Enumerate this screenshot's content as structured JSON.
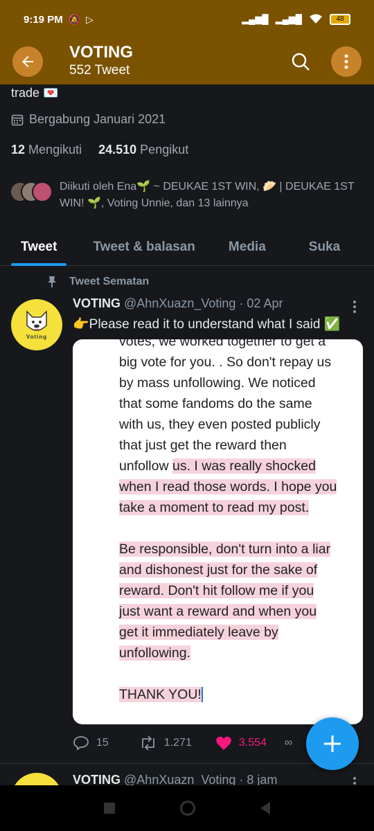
{
  "status_bar": {
    "time": "9:19 PM",
    "battery": "48"
  },
  "header": {
    "title": "VOTING",
    "subtitle": "552 Tweet"
  },
  "profile": {
    "bio_tail": "trade 💌",
    "joined": "Bergabung Januari 2021",
    "following_count": "12",
    "following_label": "Mengikuti",
    "followers_count": "24.510",
    "followers_label": "Pengikut",
    "followed_by": "Diikuti oleh Ena🌱 ~ DEUKAE 1ST WIN, 🥟 | DEUKAE 1ST WIN! 🌱, Voting Unnie, dan 13 lainnya"
  },
  "tabs": [
    {
      "label": "Tweet"
    },
    {
      "label": "Tweet & balasan"
    },
    {
      "label": "Media"
    },
    {
      "label": "Suka"
    }
  ],
  "pinned_tweet": {
    "pinned_label": "Tweet Sematan",
    "name": "VOTING",
    "handle_time": "@AhnXuazn_Voting · 02 Apr",
    "text": "👉Please read it to understand what I said ✅",
    "avatar_label": "Voting",
    "image_lines": {
      "l1": "votes, we worked together to get a",
      "l2": "big vote for you. . So don't repay us",
      "l3": "by mass unfollowing. We noticed",
      "l4": "that some fandoms do the same",
      "l5": "with us, they even posted publicly",
      "l6": "that just get the reward then",
      "l7a": "unfollow ",
      "l7b": "us. I was really shocked",
      "l8": "when I read those words. I hope you",
      "l9": "take a moment to read my post.",
      "l10": " Be responsible, don't turn into a liar",
      "l11": "and dishonest just for the sake of",
      "l12": "reward. Don't hit follow me if you",
      "l13": "just want a reward and when you",
      "l14": "get it immediately leave by",
      "l15": "unfollowing.",
      "l16": "THANK YOU!"
    },
    "replies": "15",
    "retweets": "1.271",
    "likes": "3.554"
  },
  "next_tweet": {
    "name": "VOTING",
    "handle_time": "@AhnXuazn_Voting · 8 jam"
  },
  "colors": {
    "header_bg": "#7a5200",
    "accent": "#1d9bf0",
    "like": "#f91880",
    "highlight": "#f6d3dc"
  }
}
